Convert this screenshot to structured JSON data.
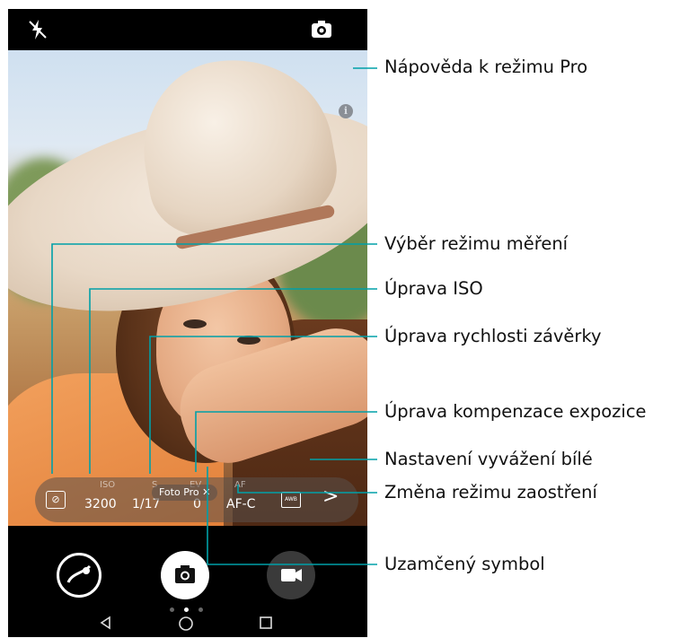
{
  "camera": {
    "pro_params": {
      "iso": {
        "label": "ISO",
        "value": "3200"
      },
      "shutter": {
        "label": "S",
        "value": "1/17"
      },
      "ev": {
        "label": "EV",
        "value": "0"
      },
      "af": {
        "label": "AF",
        "value": "AF-C"
      },
      "awb_icon_text": "AWB"
    },
    "mode_badge": "Foto Pro ✕",
    "info_icon": "i"
  },
  "icons": {
    "flash": "flash-off-icon",
    "switch_camera": "switch-camera-icon",
    "metering": "metering-mode-icon",
    "awb": "white-balance-icon",
    "next": "chevron-right-icon",
    "gallery": "gallery-icon",
    "shutter": "camera-shutter-icon",
    "video": "video-camera-icon",
    "back": "nav-back-icon",
    "home": "nav-home-icon",
    "recents": "nav-recents-icon"
  },
  "callouts": {
    "pro_help": "Nápověda k režimu Pro",
    "metering": "Výběr režimu měření",
    "iso": "Úprava ISO",
    "shutter": "Úprava rychlosti závěrky",
    "ev": "Úprava kompenzace expozice",
    "awb": "Nastavení vyvážení bílé",
    "af": "Změna režimu zaostření",
    "lock": "Uzamčený symbol"
  },
  "colors": {
    "leader": "#00a0a8"
  }
}
